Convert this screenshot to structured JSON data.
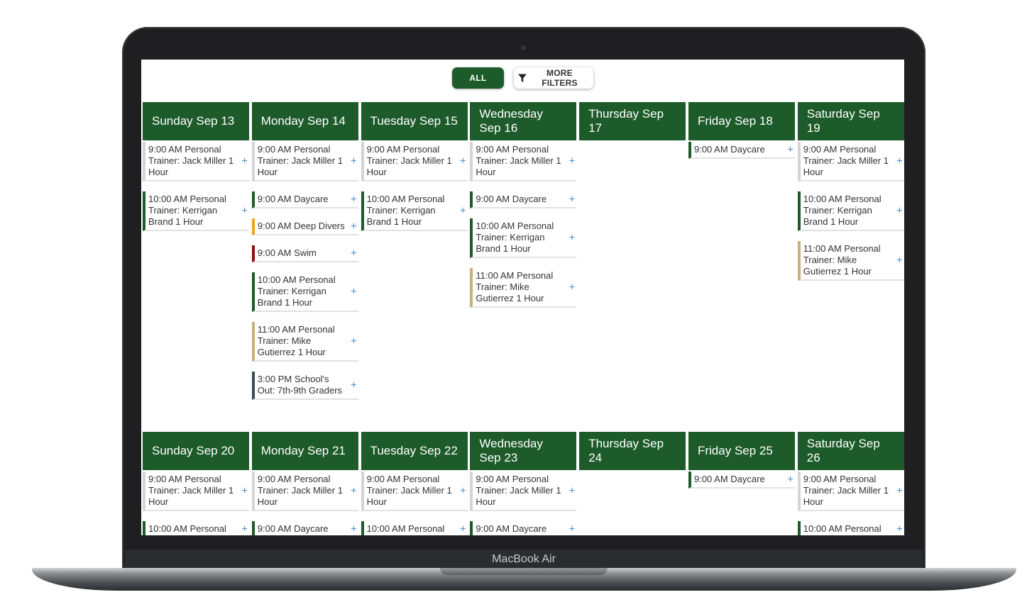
{
  "device": {
    "label": "MacBook Air"
  },
  "filters": {
    "all_label": "ALL",
    "more_label": "MORE FILTERS"
  },
  "weeks": [
    {
      "days": [
        {
          "title": "Sunday Sep 13",
          "events": [
            {
              "text": "9:00 AM Personal Trainer: Jack Miller 1 Hour",
              "color": "none"
            },
            {
              "text": "10:00 AM Personal Trainer: Kerrigan Brand 1 Hour",
              "color": "green"
            }
          ]
        },
        {
          "title": "Monday Sep 14",
          "events": [
            {
              "text": "9:00 AM Personal Trainer: Jack Miller 1 Hour",
              "color": "none"
            },
            {
              "text": "9:00 AM Daycare",
              "color": "green"
            },
            {
              "text": "9:00 AM Deep Divers",
              "color": "orange"
            },
            {
              "text": "9:00 AM Swim",
              "color": "red"
            },
            {
              "text": "10:00 AM Personal Trainer: Kerrigan Brand 1 Hour",
              "color": "green"
            },
            {
              "text": "11:00 AM Personal Trainer: Mike Gutierrez 1 Hour",
              "color": "tan"
            },
            {
              "text": "3:00 PM School's Out: 7th-9th Graders",
              "color": "slate"
            }
          ]
        },
        {
          "title": "Tuesday Sep 15",
          "events": [
            {
              "text": "9:00 AM Personal Trainer: Jack Miller 1 Hour",
              "color": "none"
            },
            {
              "text": "10:00 AM Personal Trainer: Kerrigan Brand 1 Hour",
              "color": "green"
            }
          ]
        },
        {
          "title": "Wednesday Sep 16",
          "events": [
            {
              "text": "9:00 AM Personal Trainer: Jack Miller 1 Hour",
              "color": "none"
            },
            {
              "text": "9:00 AM Daycare",
              "color": "green"
            },
            {
              "text": "10:00 AM Personal Trainer: Kerrigan Brand 1 Hour",
              "color": "green"
            },
            {
              "text": "11:00 AM Personal Trainer: Mike Gutierrez 1 Hour",
              "color": "tan"
            }
          ]
        },
        {
          "title": "Thursday Sep 17",
          "events": []
        },
        {
          "title": "Friday Sep 18",
          "events": [
            {
              "text": "9:00 AM Daycare",
              "color": "green"
            }
          ]
        },
        {
          "title": "Saturday Sep 19",
          "events": [
            {
              "text": "9:00 AM Personal Trainer: Jack Miller 1 Hour",
              "color": "none"
            },
            {
              "text": "10:00 AM Personal Trainer: Kerrigan Brand 1 Hour",
              "color": "green"
            },
            {
              "text": "11:00 AM Personal Trainer: Mike Gutierrez 1 Hour",
              "color": "tan"
            }
          ]
        }
      ]
    },
    {
      "days": [
        {
          "title": "Sunday Sep 20",
          "events": [
            {
              "text": "9:00 AM Personal Trainer: Jack Miller 1 Hour",
              "color": "none"
            },
            {
              "text": "10:00 AM Personal",
              "color": "green"
            }
          ]
        },
        {
          "title": "Monday Sep 21",
          "events": [
            {
              "text": "9:00 AM Personal Trainer: Jack Miller 1 Hour",
              "color": "none"
            },
            {
              "text": "9:00 AM Daycare",
              "color": "green"
            }
          ]
        },
        {
          "title": "Tuesday Sep 22",
          "events": [
            {
              "text": "9:00 AM Personal Trainer: Jack Miller 1 Hour",
              "color": "none"
            },
            {
              "text": "10:00 AM Personal",
              "color": "green"
            }
          ]
        },
        {
          "title": "Wednesday Sep 23",
          "events": [
            {
              "text": "9:00 AM Personal Trainer: Jack Miller 1 Hour",
              "color": "none"
            },
            {
              "text": "9:00 AM Daycare",
              "color": "green"
            }
          ]
        },
        {
          "title": "Thursday Sep 24",
          "events": []
        },
        {
          "title": "Friday Sep 25",
          "events": [
            {
              "text": "9:00 AM Daycare",
              "color": "green"
            }
          ]
        },
        {
          "title": "Saturday Sep 26",
          "events": [
            {
              "text": "9:00 AM Personal Trainer: Jack Miller 1 Hour",
              "color": "none"
            },
            {
              "text": "10:00 AM Personal",
              "color": "green"
            }
          ]
        }
      ]
    }
  ]
}
